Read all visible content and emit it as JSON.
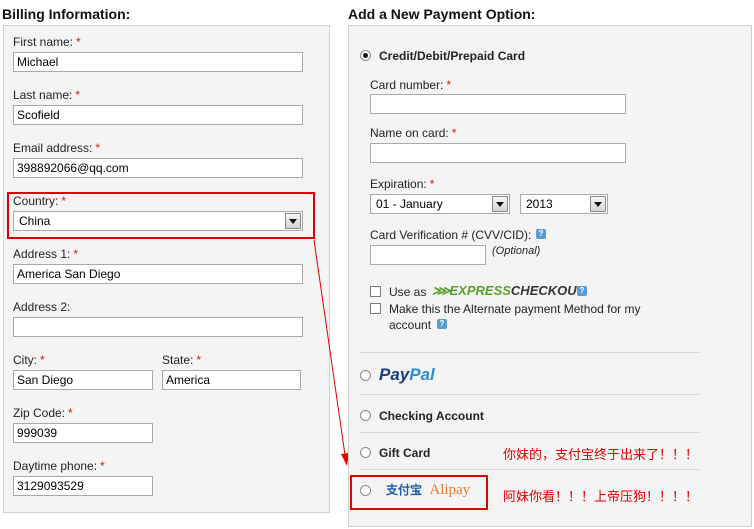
{
  "billing": {
    "title": "Billing Information:",
    "required_mark": "*",
    "first_name": {
      "label": "First name:",
      "value": "Michael"
    },
    "last_name": {
      "label": "Last name:",
      "value": "Scofield"
    },
    "email": {
      "label": "Email address:",
      "value": "398892066@qq.com"
    },
    "country": {
      "label": "Country:",
      "value": "China"
    },
    "address1": {
      "label": "Address 1:",
      "value": "America San Diego"
    },
    "address2": {
      "label": "Address 2:",
      "value": ""
    },
    "city": {
      "label": "City:",
      "value": "San Diego"
    },
    "state": {
      "label": "State:",
      "value": "America"
    },
    "zip": {
      "label": "Zip Code:",
      "value": "999039"
    },
    "phone": {
      "label": "Daytime phone:",
      "value": "3129093529"
    }
  },
  "payment": {
    "title": "Add a New Payment Option:",
    "card": {
      "option_label": "Credit/Debit/Prepaid Card",
      "number_label": "Card number:",
      "name_label": "Name on card:",
      "expiration_label": "Expiration:",
      "exp_month": "01 - January",
      "exp_year": "2013",
      "cvv_label": "Card Verification # (CVV/CID):",
      "cvv_optional": "(Optional)",
      "use_as_label": "Use as",
      "express_brand_a": "EXPRESS",
      "express_brand_b": "CHECKOUT",
      "alternate_label_1": "Make this the Alternate payment Method for my",
      "alternate_label_2": "account"
    },
    "paypal": {
      "brand_a": "Pay",
      "brand_b": "Pal"
    },
    "checking": {
      "label": "Checking Account"
    },
    "gift_card": {
      "label": "Gift Card"
    },
    "alipay": {
      "logo_text": "支付宝",
      "brand": "Alipay"
    }
  },
  "annotations": {
    "note1": "你妹的，支付宝终于出来了！！！",
    "note2": "阿妹你看！！！上帝压狗！！！！"
  },
  "colors": {
    "annotation_red": "#e00000",
    "paypal_dark": "#1a3d7c",
    "paypal_light": "#2c8fd6",
    "express_green": "#5aa02c"
  }
}
